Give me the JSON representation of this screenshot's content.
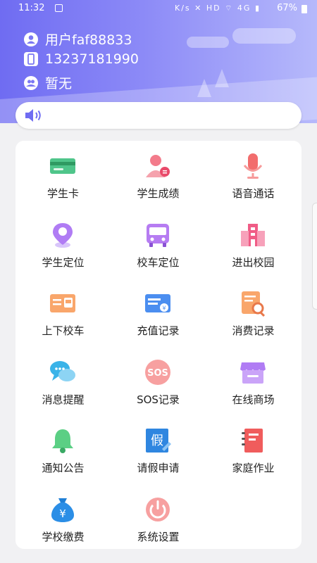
{
  "status_bar": {
    "time": "11:32",
    "icons": "K/s ✕ HD ⌔ 4G ▮",
    "battery": "67%"
  },
  "user": {
    "name": "用户faf88833",
    "phone": "13237181990",
    "extra": "暂无"
  },
  "menu": [
    {
      "label": "学生卡",
      "icon": "student-card-icon"
    },
    {
      "label": "学生成绩",
      "icon": "student-grades-icon"
    },
    {
      "label": "语音通话",
      "icon": "microphone-icon"
    },
    {
      "label": "学生定位",
      "icon": "location-pin-icon"
    },
    {
      "label": "校车定位",
      "icon": "bus-icon"
    },
    {
      "label": "进出校园",
      "icon": "school-building-icon"
    },
    {
      "label": "上下校车",
      "icon": "bus-ticket-icon"
    },
    {
      "label": "充值记录",
      "icon": "recharge-icon"
    },
    {
      "label": "消费记录",
      "icon": "consumption-search-icon"
    },
    {
      "label": "消息提醒",
      "icon": "chat-bubbles-icon"
    },
    {
      "label": "SOS记录",
      "icon": "sos-icon"
    },
    {
      "label": "在线商场",
      "icon": "store-icon"
    },
    {
      "label": "通知公告",
      "icon": "bell-icon"
    },
    {
      "label": "请假申请",
      "icon": "leave-request-icon"
    },
    {
      "label": "家庭作业",
      "icon": "homework-book-icon"
    },
    {
      "label": "学校缴费",
      "icon": "money-bag-icon"
    },
    {
      "label": "系统设置",
      "icon": "power-settings-icon"
    }
  ],
  "colors": {
    "header_start": "#6f6cf2",
    "header_end": "#b6b9fb",
    "accent": "#6f6cf2"
  }
}
